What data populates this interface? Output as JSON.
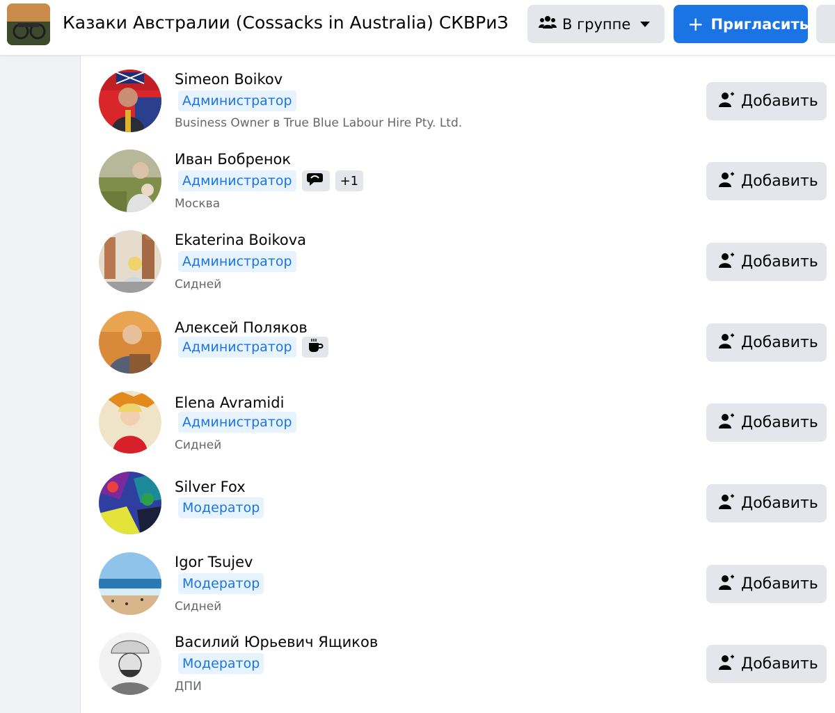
{
  "header": {
    "group_title": "Казаки Австралии (Cossacks in Australia) СКВРиЗ",
    "in_group_label": "В группе",
    "invite_label": "Пригласить"
  },
  "members": [
    {
      "name": "Simeon Boikov",
      "role": "Администратор",
      "subtitle": "Business Owner в True Blue Labour Hire Pty. Ltd.",
      "add_label": "Добавить"
    },
    {
      "name": "Иван Бобренок",
      "role": "Администратор",
      "extra_count": "+1",
      "subtitle": "Москва",
      "add_label": "Добавить"
    },
    {
      "name": "Ekaterina Boikova",
      "role": "Администратор",
      "subtitle": "Сидней",
      "add_label": "Добавить"
    },
    {
      "name": "Алексей Поляков",
      "role": "Администратор",
      "add_label": "Добавить"
    },
    {
      "name": "Elena Avramidi",
      "role": "Администратор",
      "subtitle": "Сидней",
      "add_label": "Добавить"
    },
    {
      "name": "Silver Fox",
      "role": "Модератор",
      "add_label": "Добавить"
    },
    {
      "name": "Igor Tsujev",
      "role": "Модератор",
      "subtitle": "Сидней",
      "add_label": "Добавить"
    },
    {
      "name": "Василий Юрьевич Ящиков",
      "role": "Модератор",
      "subtitle": "ДПИ",
      "add_label": "Добавить"
    }
  ],
  "colors": {
    "accent": "#1b74e4",
    "role_bg": "#e7f3ff",
    "button_gray": "#e4e6eb",
    "secondary_text": "#65676b"
  },
  "icons": [
    "group-people-icon",
    "caret-down-icon",
    "plus-icon",
    "add-friend-icon",
    "conversation-starter-icon",
    "coffee-cup-icon"
  ]
}
